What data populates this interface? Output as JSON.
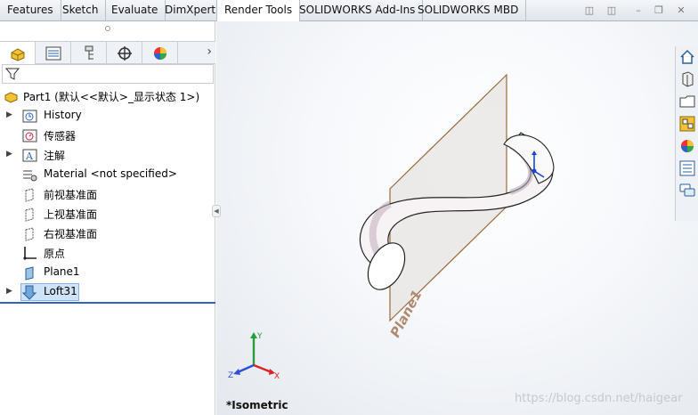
{
  "tabs": [
    "Features",
    "Sketch",
    "Evaluate",
    "DimXpert",
    "Render Tools",
    "SOLIDWORKS Add-Ins",
    "SOLIDWORKS MBD"
  ],
  "active_tab": "Render Tools",
  "tree": {
    "root": "Part1  (默认<<默认>_显示状态 1>)",
    "items": [
      {
        "label": "History",
        "icon": "history-icon",
        "expandable": true
      },
      {
        "label": "传感器",
        "icon": "sensor-icon",
        "expandable": false
      },
      {
        "label": "注解",
        "icon": "annotation-icon",
        "expandable": true
      },
      {
        "label": "Material <not specified>",
        "icon": "material-icon",
        "expandable": false
      },
      {
        "label": "前视基准面",
        "icon": "plane-icon",
        "expandable": false
      },
      {
        "label": "上视基准面",
        "icon": "plane-icon",
        "expandable": false
      },
      {
        "label": "右视基准面",
        "icon": "plane-icon",
        "expandable": false
      },
      {
        "label": "原点",
        "icon": "origin-icon",
        "expandable": false
      },
      {
        "label": "Plane1",
        "icon": "plane1-icon",
        "expandable": false
      },
      {
        "label": "Loft31",
        "icon": "loft-icon",
        "expandable": true,
        "selected": true
      }
    ]
  },
  "viewport": {
    "view_label": "*Isometric",
    "plane_label": "Plane1",
    "triad": {
      "x": "X",
      "y": "Y",
      "z": "Z"
    },
    "watermark": "https://blog.csdn.net/haigear"
  }
}
